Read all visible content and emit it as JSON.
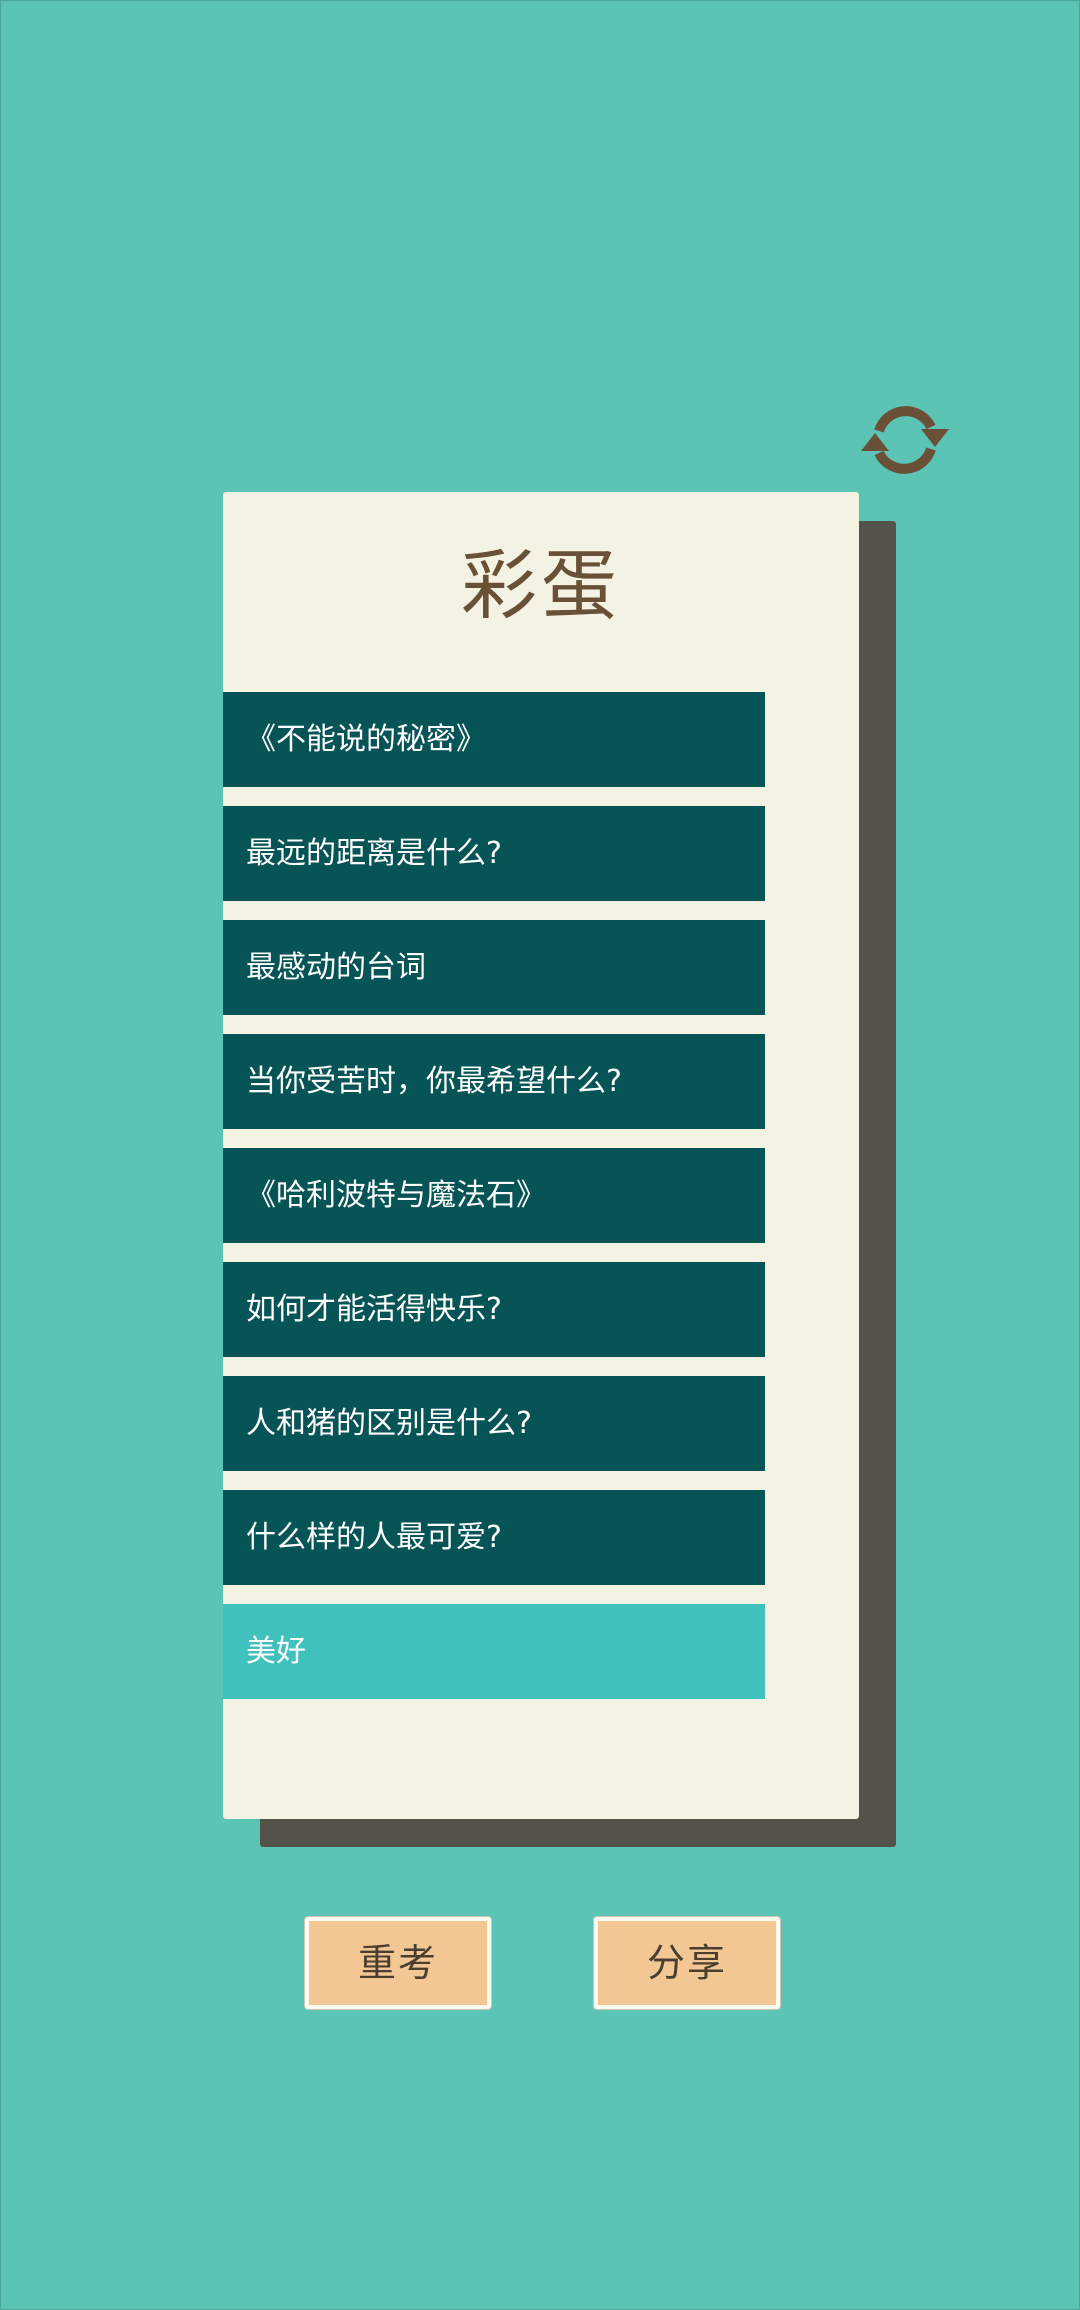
{
  "header": {
    "refresh_icon": "refresh-icon",
    "refresh_color": "#6a5037"
  },
  "card": {
    "title": "彩蛋",
    "items": [
      {
        "label": "《不能说的秘密》",
        "selected": false
      },
      {
        "label": "最远的距离是什么?",
        "selected": false
      },
      {
        "label": "最感动的台词",
        "selected": false
      },
      {
        "label": "当你受苦时，你最希望什么?",
        "selected": false
      },
      {
        "label": "《哈利波特与魔法石》",
        "selected": false
      },
      {
        "label": "如何才能活得快乐?",
        "selected": false
      },
      {
        "label": "人和猪的区别是什么?",
        "selected": false
      },
      {
        "label": "什么样的人最可爱?",
        "selected": false
      },
      {
        "label": "美好",
        "selected": true
      }
    ]
  },
  "actions": {
    "retake_label": "重考",
    "share_label": "分享"
  },
  "colors": {
    "background": "#5bc4b5",
    "card": "#f4f3e3",
    "item": "#075457",
    "item_selected": "#40c1be",
    "button": "#f3c793"
  }
}
